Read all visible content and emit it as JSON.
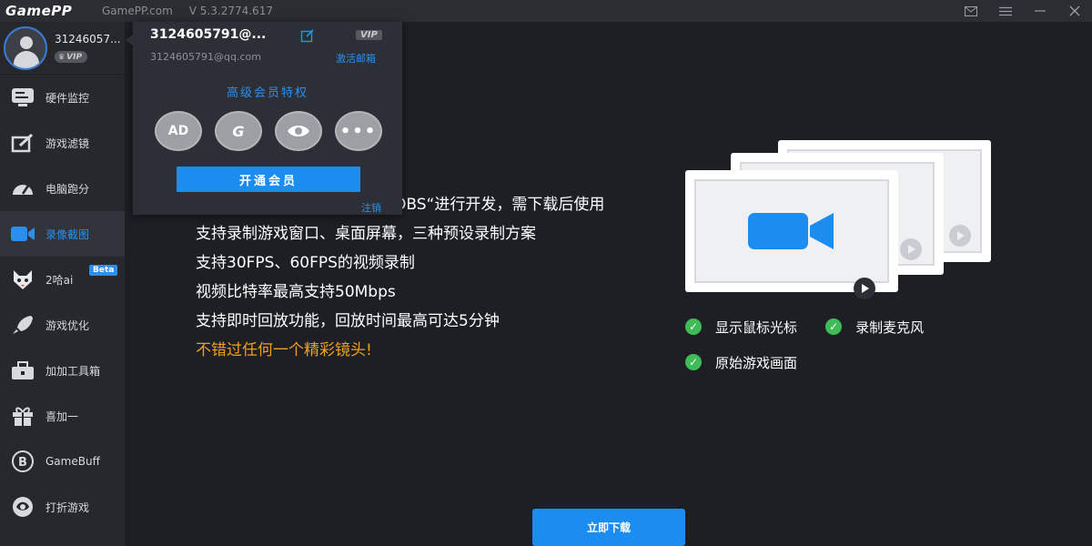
{
  "titlebar": {
    "logo": "GamePP",
    "site": "GamePP.com",
    "version": "V 5.3.2774.617"
  },
  "sidebar": {
    "user": {
      "id": "31246057...",
      "badge": "VIP"
    },
    "items": [
      {
        "label": "硬件监控",
        "icon": "hardware-monitor-icon"
      },
      {
        "label": "游戏滤镜",
        "icon": "game-filter-icon"
      },
      {
        "label": "电脑跑分",
        "icon": "benchmark-gauge-icon"
      },
      {
        "label": "录像截图",
        "icon": "video-camera-icon"
      },
      {
        "label": "2哈ai",
        "icon": "husky-ai-icon",
        "badge": "Beta"
      },
      {
        "label": "游戏优化",
        "icon": "rocket-icon"
      },
      {
        "label": "加加工具箱",
        "icon": "toolbox-icon"
      },
      {
        "label": "喜加一",
        "icon": "gift-icon"
      },
      {
        "label": "GameBuff",
        "icon": "gamebuff-icon"
      },
      {
        "label": "打折游戏",
        "icon": "discount-game-icon"
      }
    ]
  },
  "popup": {
    "username": "3124605791@...",
    "vip": "VIP",
    "email": "3124605791@qq.com",
    "activate": "激活邮箱",
    "privileges_title": "高级会员特权",
    "privilege_icons": [
      "AD",
      "G",
      "eye",
      "more"
    ],
    "open_membership": "开通会员",
    "logout": "注销"
  },
  "main": {
    "features": [
      "OBS“进行开发，需下载后使用",
      "支持录制游戏窗口、桌面屏幕，三种预设录制方案",
      "支持30FPS、60FPS的视频录制",
      "视频比特率最高支持50Mbps",
      "支持即时回放功能，回放时间最高可达5分钟"
    ],
    "highlight": "不错过任何一个精彩镜头!",
    "checks": [
      "显示鼠标光标",
      "录制麦克风",
      "原始游戏画面"
    ],
    "download": "立即下载"
  },
  "colors": {
    "accent": "#1b8df0",
    "highlight": "#f0a020",
    "check": "#3fbb58"
  }
}
